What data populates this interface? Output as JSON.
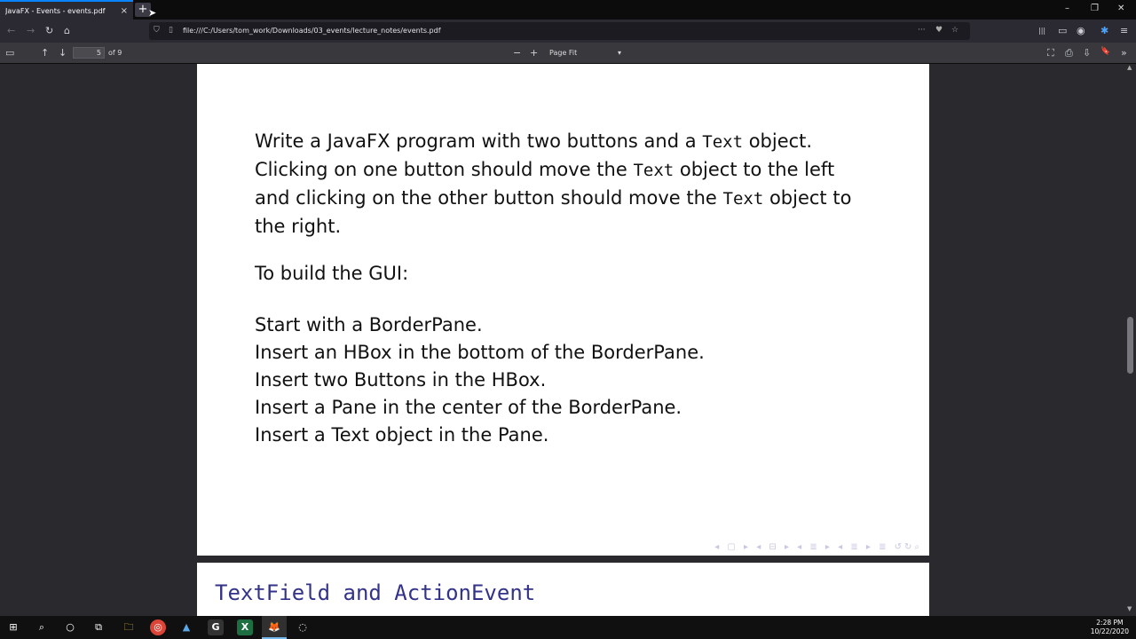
{
  "browser": {
    "tab_title": "JavaFX - Events - events.pdf",
    "tab_close": "×",
    "new_tab": "+",
    "window_controls": {
      "minimize": "–",
      "restore": "❐",
      "close": "✕"
    },
    "nav": {
      "back": "←",
      "forward": "→",
      "reload": "↻",
      "home": "⌂"
    },
    "url": "file:///C:/Users/tom_work/Downloads/03_events/lecture_notes/events.pdf",
    "url_actions": {
      "more": "···",
      "pocket": "♥",
      "bookmark": "☆"
    },
    "toolbar_right": {
      "library": "|||",
      "sidebar": "▭",
      "account": "◉",
      "extensions": "✱",
      "menu": "≡"
    }
  },
  "pdf_toolbar": {
    "sidebar_toggle": "▭",
    "prev_page": "↑",
    "next_page": "↓",
    "page_number": "5",
    "page_count": "of 9",
    "zoom_out": "−",
    "zoom_in": "+",
    "zoom_value": "Page Fit",
    "zoom_caret": "▾",
    "present": "⛶",
    "print": "⎙",
    "download": "⇩",
    "bookmark": "🔖",
    "tools": "»"
  },
  "slide": {
    "lines_intro": [
      {
        "pre": "Write a JavaFX program with two buttons and a ",
        "code": "Text",
        "post": " object."
      },
      {
        "pre": "Clicking on one button should move the ",
        "code": "Text",
        "post": " object to the left"
      },
      {
        "pre": "and clicking on the other button should move the ",
        "code": "Text",
        "post": " object to"
      },
      {
        "pre": "the right.",
        "code": "",
        "post": ""
      }
    ],
    "gui_heading": "To build the GUI:",
    "steps": [
      "Start with a BorderPane.",
      "Insert an HBox in the bottom of the BorderPane.",
      "Insert two Buttons in the HBox.",
      "Insert a Pane in the center of the BorderPane.",
      "Insert a Text object in the Pane."
    ],
    "nav_symbols": "◂ ▢ ▸  ◂ ⊟ ▸  ◂ ≣ ▸  ◂ ≣ ▸   ≣   ↺↻⌕"
  },
  "next_slide": {
    "title": "TextField and ActionEvent"
  },
  "taskbar": {
    "start": "⊞",
    "search": "⌕",
    "cortana": "○",
    "taskview": "⧉",
    "apps": [
      "🗀",
      "◎",
      "▲",
      "G",
      "X",
      "🦊",
      "◌"
    ],
    "time": "2:28 PM",
    "date": "10/22/2020"
  }
}
